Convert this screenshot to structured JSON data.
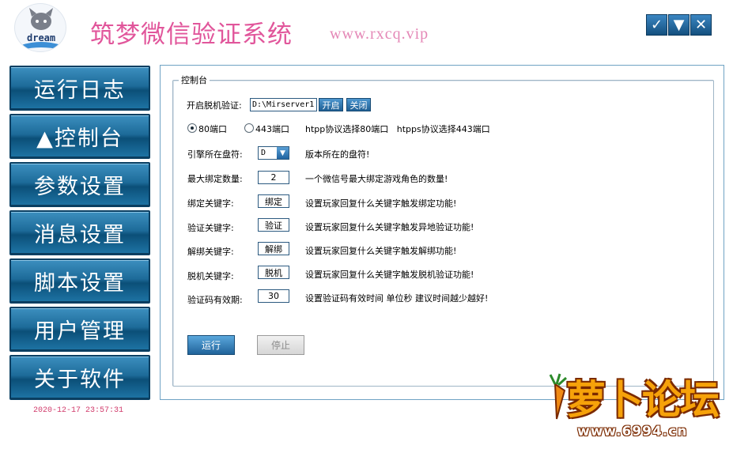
{
  "app": {
    "title": "筑梦微信验证系统",
    "url": "www.rxcq.vip",
    "logo_text": "dream"
  },
  "window_controls": [
    {
      "name": "confirm",
      "glyph": "✓"
    },
    {
      "name": "minimize",
      "glyph": "▼"
    },
    {
      "name": "close",
      "glyph": "✕"
    }
  ],
  "sidebar": {
    "items": [
      {
        "label": "运行日志"
      },
      {
        "label": "▲控制台"
      },
      {
        "label": "参数设置"
      },
      {
        "label": "消息设置"
      },
      {
        "label": "脚本设置"
      },
      {
        "label": "用户管理"
      },
      {
        "label": "关于软件"
      }
    ],
    "clock": "2020-12-17 23:57:31"
  },
  "panel": {
    "group_title": "控制台",
    "offline_verify": {
      "label": "开启脱机验证:",
      "path_value": "D:\\Mirserver1",
      "open_btn": "开启",
      "close_btn": "关闭"
    },
    "ports": {
      "option_80": "80端口",
      "option_443": "443端口",
      "selected": "80",
      "note": "htpp协议选择80端口   htpps协议选择443端口"
    },
    "rows": {
      "drive": {
        "label": "引擎所在盘符:",
        "value": "D",
        "desc": "版本所在的盘符!"
      },
      "max_bind": {
        "label": "最大绑定数量:",
        "value": "2",
        "desc": "一个微信号最大绑定游戏角色的数量!"
      },
      "bind_kw": {
        "label": "绑定关键字:",
        "value": "绑定",
        "desc": "设置玩家回复什么关键字触发绑定功能!"
      },
      "verify_kw": {
        "label": "验证关键字:",
        "value": "验证",
        "desc": "设置玩家回复什么关键字触发异地验证功能!"
      },
      "unbind_kw": {
        "label": "解绑关键字:",
        "value": "解绑",
        "desc": "设置玩家回复什么关键字触发解绑功能!"
      },
      "offline_kw": {
        "label": "脱机关键字:",
        "value": "脱机",
        "desc": "设置玩家回复什么关键字触发脱机验证功能!"
      },
      "code_ttl": {
        "label": "验证码有效期:",
        "value": "30",
        "desc": "设置验证码有效时间 单位秒 建议时间越少越好!"
      }
    },
    "run_btn": "运行",
    "stop_btn": "停止"
  },
  "watermark": {
    "text": "萝卜论坛",
    "url": "www.6994.cn"
  },
  "colors": {
    "title_pink": "#e1569b",
    "sidebar_blue": "#1d6b99",
    "clock_red": "#d13b6b"
  }
}
